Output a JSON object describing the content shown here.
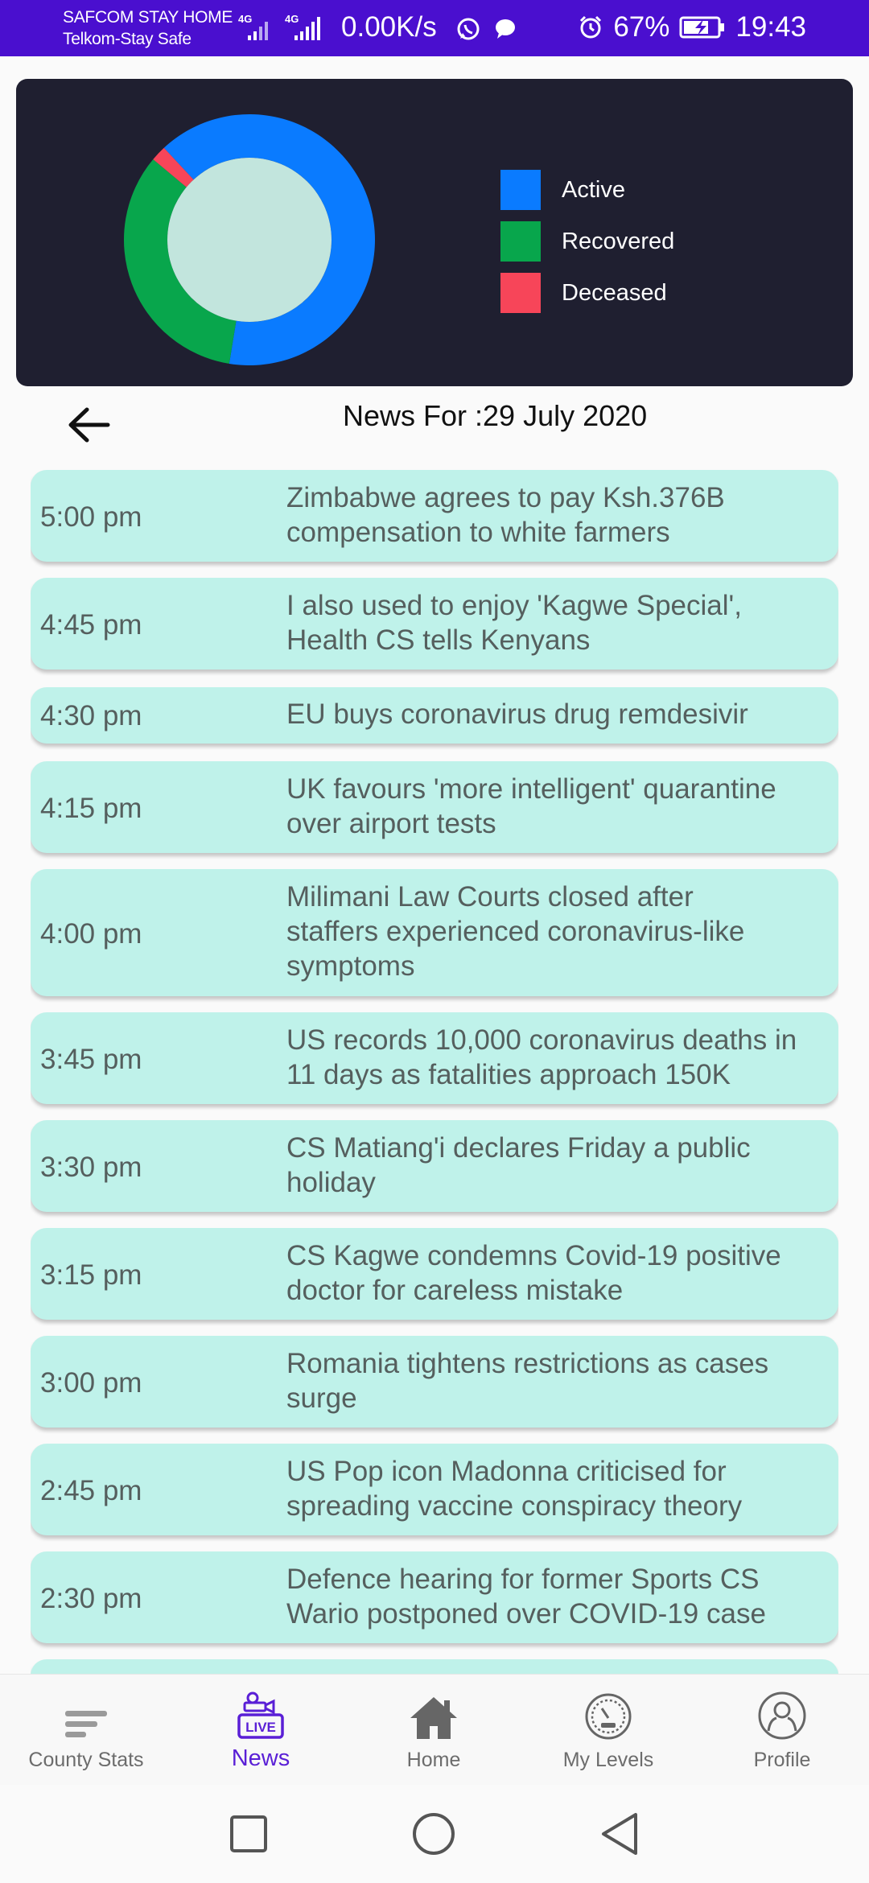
{
  "status_bar": {
    "carrier1": "SAFCOM STAY HOME",
    "carrier2": "Telkom-Stay Safe",
    "network1": "4G",
    "network2": "4G",
    "speed": "0.00K/s",
    "battery": "67%",
    "time": "19:43"
  },
  "chart_data": {
    "type": "pie",
    "categories": [
      "Active",
      "Recovered",
      "Deceased"
    ],
    "values": [
      64.5,
      33.5,
      2.0
    ],
    "colors": [
      "#0a7bff",
      "#08a64c",
      "#f74559"
    ],
    "legend_position": "right"
  },
  "legend": [
    {
      "label": "Active",
      "color": "#0a7bff"
    },
    {
      "label": "Recovered",
      "color": "#08a64c"
    },
    {
      "label": "Deceased",
      "color": "#f74559"
    }
  ],
  "news_title": "News For :29 July 2020",
  "news": [
    {
      "time": "5:00 pm",
      "lines": [
        "Zimbabwe agrees to pay Ksh.376B",
        "compensation to white farmers"
      ]
    },
    {
      "time": "4:45 pm",
      "lines": [
        "I also used to enjoy 'Kagwe Special',",
        "Health CS tells Kenyans"
      ]
    },
    {
      "time": "4:30 pm",
      "lines": [
        "EU buys coronavirus drug remdesivir"
      ]
    },
    {
      "time": "4:15 pm",
      "lines": [
        "UK favours 'more intelligent' quarantine",
        "over airport tests"
      ]
    },
    {
      "time": "4:00 pm",
      "lines": [
        "Milimani Law Courts closed after",
        "staffers experienced coronavirus-like",
        "symptoms"
      ]
    },
    {
      "time": "3:45 pm",
      "lines": [
        "US records 10,000 coronavirus deaths in",
        "11 days as fatalities approach 150K"
      ]
    },
    {
      "time": "3:30 pm",
      "lines": [
        "CS Matiang'i declares Friday a public",
        "holiday"
      ]
    },
    {
      "time": "3:15 pm",
      "lines": [
        "CS Kagwe condemns Covid-19 positive",
        "doctor for careless mistake"
      ]
    },
    {
      "time": "3:00 pm",
      "lines": [
        "Romania tightens restrictions as cases",
        "surge"
      ]
    },
    {
      "time": "2:45 pm",
      "lines": [
        "US Pop icon Madonna criticised for",
        "spreading vaccine conspiracy theory"
      ]
    },
    {
      "time": "2:30 pm",
      "lines": [
        "Defence hearing for former Sports CS",
        "Wario postponed over COVID-19 case"
      ]
    },
    {
      "time": "",
      "lines": []
    }
  ],
  "nav": [
    {
      "label": "County Stats",
      "icon": "bars-icon"
    },
    {
      "label": "News",
      "icon": "live-tv-icon",
      "badge": "LIVE"
    },
    {
      "label": "Home",
      "icon": "home-icon"
    },
    {
      "label": "My Levels",
      "icon": "gauge-icon"
    },
    {
      "label": "Profile",
      "icon": "profile-icon"
    }
  ]
}
